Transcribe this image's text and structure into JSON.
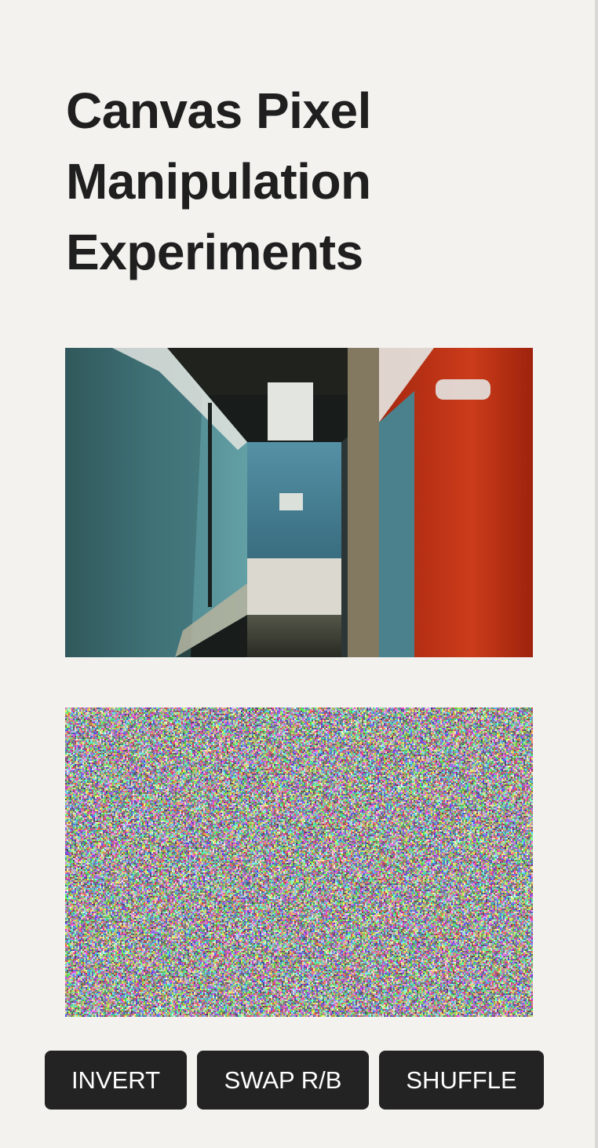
{
  "page": {
    "title": "Canvas Pixel Manipulation Experiments"
  },
  "images": {
    "source_photo": "photo",
    "output_canvas": "canvas"
  },
  "buttons": {
    "invert": "INVERT",
    "swap": "SWAP R/B",
    "shuffle": "SHUFFLE"
  },
  "colors": {
    "background": "#f3f2ef",
    "button_bg": "#232323",
    "button_text": "#ffffff",
    "title_text": "#1f1f1f"
  }
}
